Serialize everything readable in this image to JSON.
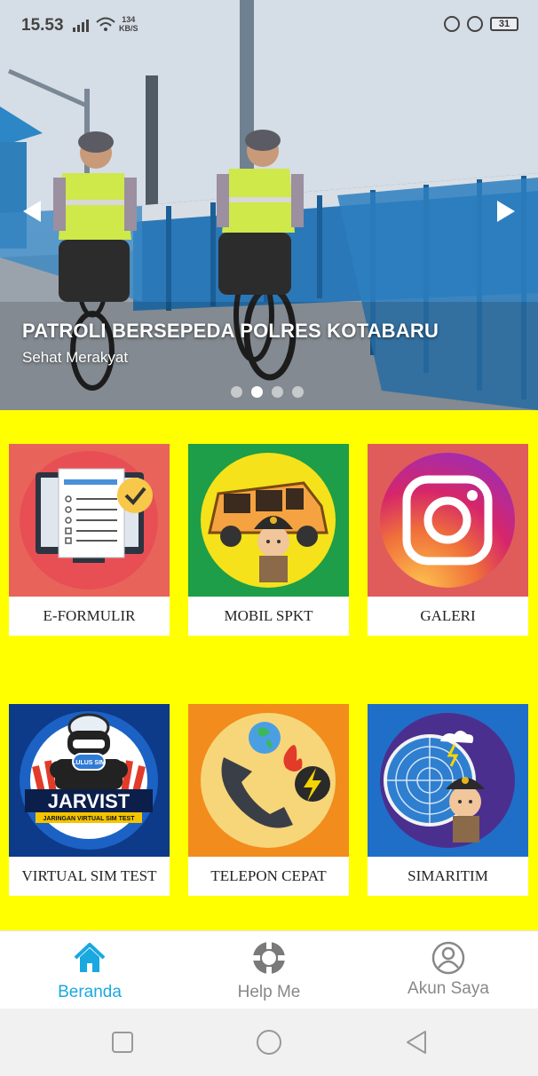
{
  "status_bar": {
    "time": "15.53",
    "net_speed_value": "134",
    "net_speed_unit": "KB/S",
    "battery": "31"
  },
  "banner": {
    "title": "PATROLI BERSEPEDA POLRES KOTABARU",
    "subtitle": "Sehat Merakyat",
    "slide_count": 4,
    "active_slide": 2
  },
  "menu": {
    "items": [
      {
        "label": "E-FORMULIR",
        "icon": "form-checklist-icon",
        "color": "#e8645a"
      },
      {
        "label": "MOBIL SPKT",
        "icon": "police-car-icon",
        "color": "#1e9e48"
      },
      {
        "label": "GALERI",
        "icon": "instagram-icon",
        "color": "#e05c5a"
      },
      {
        "label": "VIRTUAL SIM TEST",
        "icon": "jarvist-icon",
        "color": "#0e3a8a"
      },
      {
        "label": "TELEPON CEPAT",
        "icon": "phone-emergency-icon",
        "color": "#f28c1c"
      },
      {
        "label": "SIMARITIM",
        "icon": "radar-weather-icon",
        "color": "#1f6fc8"
      }
    ]
  },
  "jarvist": {
    "badge": "LULUS SIM",
    "title": "JARVIST",
    "subtitle": "JARINGAN VIRTUAL SIM TEST"
  },
  "bottom_nav": {
    "items": [
      {
        "label": "Beranda",
        "icon": "home-icon",
        "active": true
      },
      {
        "label": "Help Me",
        "icon": "lifebuoy-icon",
        "active": false
      },
      {
        "label": "Akun Saya",
        "icon": "user-icon",
        "active": false
      }
    ]
  },
  "colors": {
    "background": "#ffff00",
    "active_nav": "#1aa8e0",
    "inactive_nav": "#888888"
  }
}
